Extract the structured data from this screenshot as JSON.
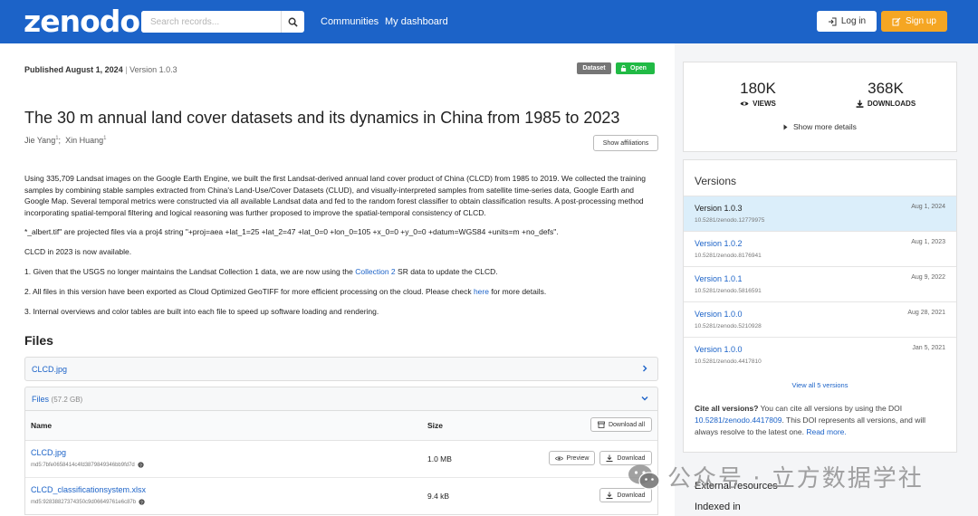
{
  "header": {
    "logo": "zenodo",
    "search_placeholder": "Search records...",
    "nav": [
      "Communities",
      "My dashboard"
    ],
    "login": "Log in",
    "signup": "Sign up"
  },
  "record": {
    "published": "Published August 1, 2024",
    "version_sep": "|",
    "version": "Version 1.0.3",
    "badge_type": "Dataset",
    "badge_access": "Open",
    "title": "The 30 m annual land cover datasets and its dynamics in China from 1985 to 2023",
    "authors": [
      {
        "name": "Jie Yang",
        "sup": "1"
      },
      {
        "name": "Xin Huang",
        "sup": "1"
      }
    ],
    "author_sep": ";",
    "show_affiliations": "Show affiliations",
    "description": {
      "p1": "Using 335,709 Landsat images on the Google Earth Engine, we built the first Landsat-derived annual land cover product of China (CLCD) from 1985 to 2019. We collected the training samples by combining stable samples extracted from China's Land-Use/Cover Datasets (CLUD), and visually-interpreted samples from satellite time-series data, Google Earth and Google Map. Several temporal metrics were constructed via all available Landsat data and fed to the random forest classifier to obtain classification results. A post-processing method incorporating spatial-temporal filtering and logical reasoning was further proposed to improve the spatial-temporal consistency of CLCD.",
      "p2": "*_albert.tif\" are projected files via a proj4 string \"+proj=aea +lat_1=25 +lat_2=47 +lat_0=0 +lon_0=105 +x_0=0 +y_0=0 +datum=WGS84 +units=m +no_defs\".",
      "p3": "CLCD in 2023 is now available.",
      "p4_pre": "1. Given that the USGS no longer maintains the Landsat Collection 1 data, we are now using the ",
      "p4_link": "Collection 2",
      "p4_post": " SR data to update the CLCD.",
      "p5_pre": "2. All files in this version have been exported as Cloud Optimized GeoTIFF for more efficient processing on the cloud. Please check ",
      "p5_link": "here",
      "p5_post": " for more details.",
      "p6": "3. Internal overviews and color tables are built into each file to speed up software loading and rendering."
    }
  },
  "files": {
    "heading": "Files",
    "preview_file": "CLCD.jpg",
    "files_label": "Files",
    "files_size": "(57.2 GB)",
    "col_name": "Name",
    "col_size": "Size",
    "download_all": "Download all",
    "rows": [
      {
        "name": "CLCD.jpg",
        "md5": "md5:7bfe0658414c4fd3879849346bb9fd7d",
        "size": "1.0 MB",
        "preview": "Preview",
        "download": "Download"
      },
      {
        "name": "CLCD_classificationsystem.xlsx",
        "md5": "md5:92838827374350c9d06649761e6c87b",
        "size": "9.4 kB",
        "download": "Download"
      }
    ]
  },
  "stats": {
    "views": "180K",
    "views_label": "VIEWS",
    "downloads": "368K",
    "downloads_label": "DOWNLOADS",
    "more": "Show more details"
  },
  "versions": {
    "heading": "Versions",
    "items": [
      {
        "name": "Version 1.0.3",
        "date": "Aug 1, 2024",
        "doi": "10.5281/zenodo.12779975"
      },
      {
        "name": "Version 1.0.2",
        "date": "Aug 1, 2023",
        "doi": "10.5281/zenodo.8176941"
      },
      {
        "name": "Version 1.0.1",
        "date": "Aug 9, 2022",
        "doi": "10.5281/zenodo.5816591"
      },
      {
        "name": "Version 1.0.0",
        "date": "Aug 28, 2021",
        "doi": "10.5281/zenodo.5210928"
      },
      {
        "name": "Version 1.0.0",
        "date": "Jan 5, 2021",
        "doi": "10.5281/zenodo.4417810"
      }
    ],
    "view_all": "View all 5 versions",
    "cite_bold": "Cite all versions?",
    "cite_pre": " You can cite all versions by using the DOI ",
    "cite_doi": "10.5281/zenodo.4417809",
    "cite_post": ". This DOI represents all versions, and will always resolve to the latest one. ",
    "read_more": "Read more."
  },
  "sidebar_more": {
    "external": "External resources",
    "indexed": "Indexed in"
  },
  "watermark": "公众号 · 立方数据学社",
  "colors": {
    "brand_blue": "#1c63c8",
    "signup_orange": "#f5a623",
    "open_green": "#21ba45",
    "active_version": "#dbeefa"
  }
}
